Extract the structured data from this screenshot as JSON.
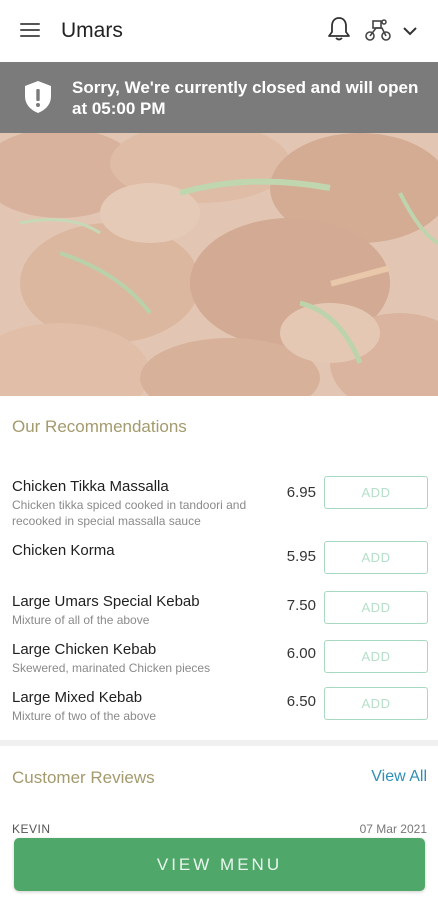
{
  "header": {
    "title": "Umars",
    "icons": [
      "menu-icon",
      "bell-icon",
      "rider-icon",
      "chevron-down-icon"
    ]
  },
  "banner": {
    "icon": "shield-alert-icon",
    "text": "Sorry, We're currently closed and will open at 05:00 PM",
    "color": "#7b7b7b"
  },
  "recommendations": {
    "title": "Our Recommendations",
    "items": [
      {
        "name": "Chicken Tikka Massalla",
        "description": "Chicken tikka spiced cooked in tandoori and recooked in special massalla sauce",
        "price": "6.95",
        "button": "ADD"
      },
      {
        "name": "Chicken Korma",
        "description": "",
        "price": "5.95",
        "button": "ADD"
      },
      {
        "name": "Large Umars Special Kebab",
        "description": "Mixture of all of the above",
        "price": "7.50",
        "button": "ADD"
      },
      {
        "name": "Large Chicken Kebab",
        "description": "Skewered, marinated Chicken pieces",
        "price": "6.00",
        "button": "ADD"
      },
      {
        "name": "Large Mixed Kebab",
        "description": "Mixture of two of the above",
        "price": "6.50",
        "button": "ADD"
      }
    ]
  },
  "reviews": {
    "title": "Customer Reviews",
    "view_all": "View All",
    "first": {
      "name": "KEVIN",
      "date": "07 Mar 2021"
    }
  },
  "footer": {
    "view_menu": "VIEW MENU",
    "color": "#4fa86a"
  }
}
